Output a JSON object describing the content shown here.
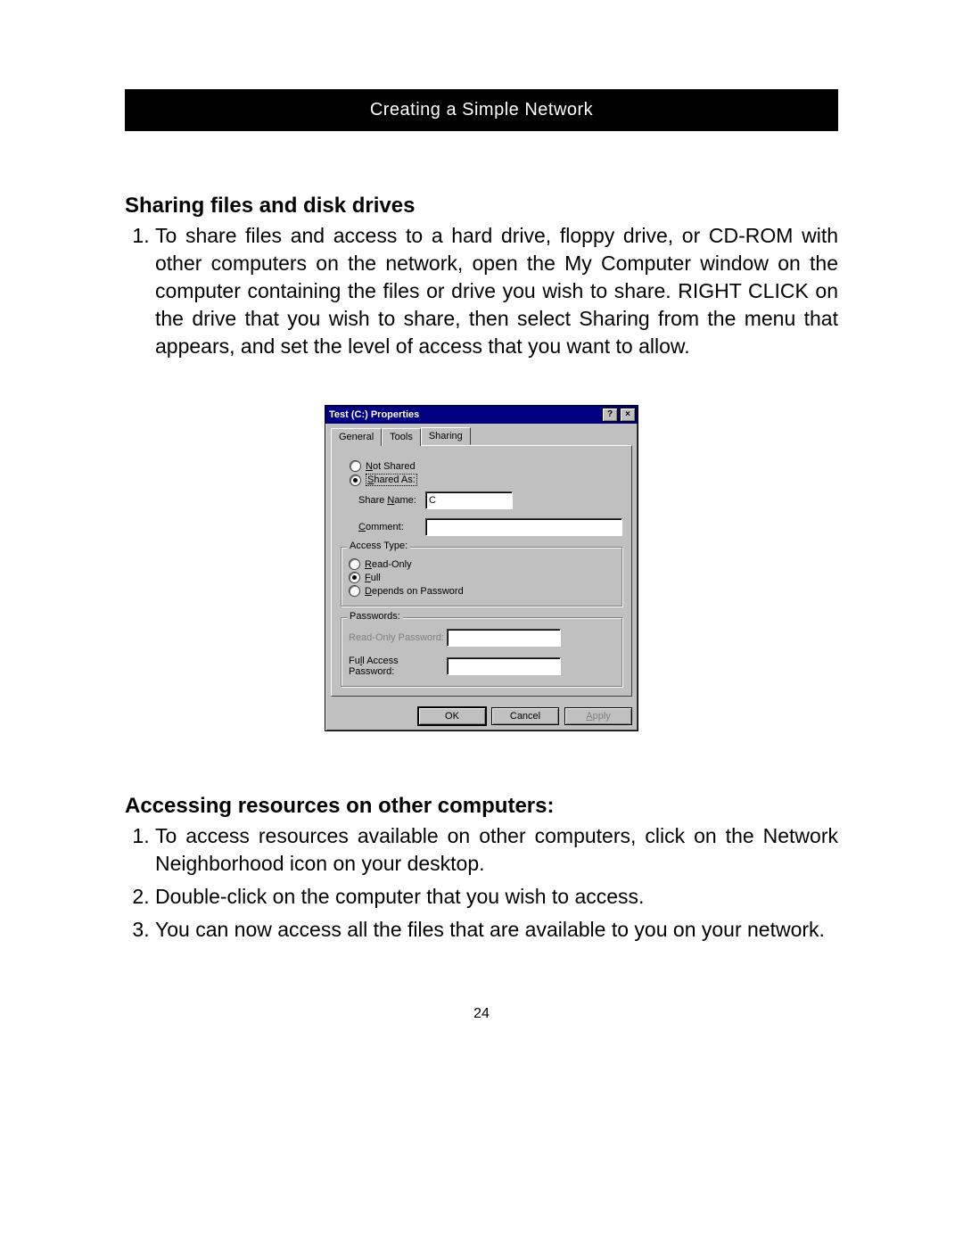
{
  "header": {
    "title": "Creating a Simple Network"
  },
  "section1": {
    "title": "Sharing files and disk drives",
    "items": [
      "To share files and access to a hard drive, floppy drive, or CD-ROM with other computers on the network, open the My Computer window on the computer containing the files or drive you wish to share. RIGHT CLICK on the drive that you wish to share, then select Sharing from the menu that appears, and set the level of access that you want to allow."
    ]
  },
  "dialog": {
    "title": "Test (C:) Properties",
    "help_btn": "?",
    "close_btn": "×",
    "tabs": {
      "general": "General",
      "tools": "Tools",
      "sharing": "Sharing"
    },
    "shared": {
      "not_shared": "Not Shared",
      "shared_as": "Shared As:",
      "share_name_label": "Share Name:",
      "share_name_value": "C",
      "comment_label": "Comment:",
      "comment_value": ""
    },
    "access": {
      "legend": "Access Type:",
      "read_only": "Read-Only",
      "full": "Full",
      "depends": "Depends on Password"
    },
    "passwords": {
      "legend": "Passwords:",
      "ro_label": "Read-Only Password:",
      "ro_value": "",
      "full_label": "Full Access Password:",
      "full_value": ""
    },
    "buttons": {
      "ok": "OK",
      "cancel": "Cancel",
      "apply": "Apply"
    }
  },
  "section2": {
    "title": "Accessing resources on other computers:",
    "items": [
      "To access resources available on other computers, click on the Network Neighborhood icon on your desktop.",
      "Double-click on the computer that you wish to access.",
      "You can now access all the files that are available to you on your network."
    ]
  },
  "page_number": "24"
}
